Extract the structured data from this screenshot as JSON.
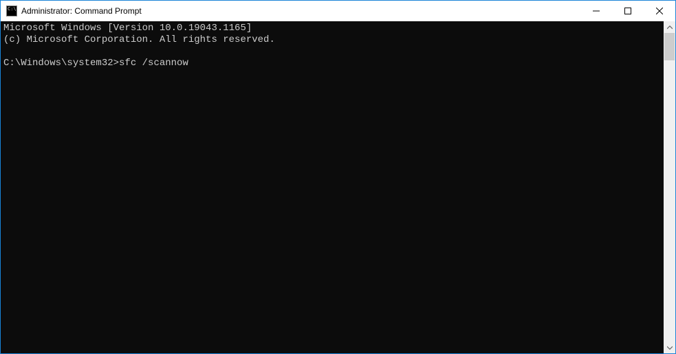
{
  "window": {
    "title": "Administrator: Command Prompt"
  },
  "console": {
    "line1": "Microsoft Windows [Version 10.0.19043.1165]",
    "line2": "(c) Microsoft Corporation. All rights reserved.",
    "blank": "",
    "prompt": "C:\\Windows\\system32>",
    "command": "sfc /scannow"
  }
}
